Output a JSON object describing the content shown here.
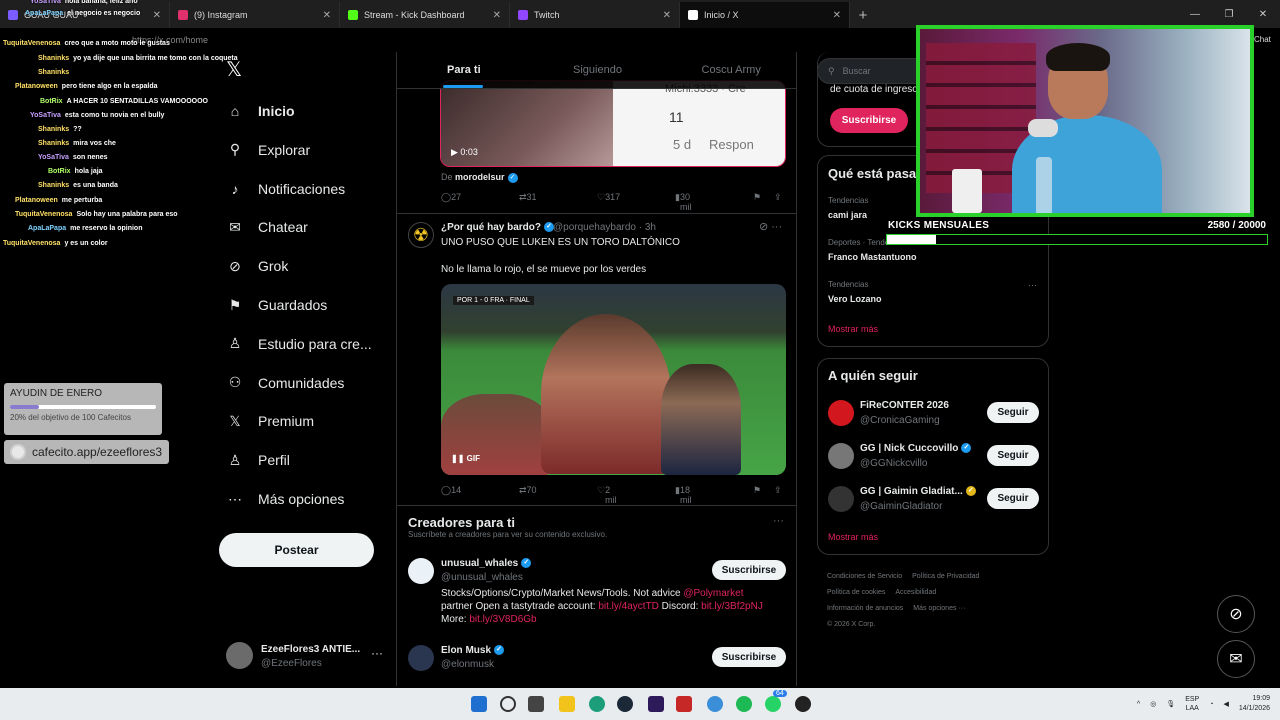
{
  "browser": {
    "tabs": [
      {
        "label": "GUAU GUAU",
        "prefix": "6dBqRix",
        "color": "#7b5cff"
      },
      {
        "label": "(9) Instagram",
        "color": "#e1306c"
      },
      {
        "label": "Stream - Kick Dashboard",
        "color": "#53fc18"
      },
      {
        "label": "Twitch",
        "color": "#9146ff"
      },
      {
        "label": "Inicio / X",
        "color": "#ffffff"
      }
    ],
    "url": "https://x.com/home",
    "chat_label": "Chat"
  },
  "chat": [
    {
      "user": "YoSaTiva",
      "text": "hola banana, feliz año",
      "color": "#c8a2ff"
    },
    {
      "user": "ApaLaPapa",
      "text": "el negocio es negocio",
      "color": "#7fd3ff"
    },
    {
      "user": "TuquitaVenenosa",
      "text": "creo que a moto moto le gustas",
      "color": "#ffe066"
    },
    {
      "user": "Shaninks",
      "text": "yo ya dije que una birrita me tomo con la coqueta",
      "color": "#ffe066"
    },
    {
      "user": "Shaninks",
      "text": "",
      "color": "#ffe066"
    },
    {
      "user": "Platanoween",
      "text": "pero tiene algo en la espalda",
      "color": "#ffe066"
    },
    {
      "user": "BotRix",
      "text": "A HACER 10 SENTADILLAS VAMOOOOOO",
      "color": "#b0ff6a"
    },
    {
      "user": "YoSaTiva",
      "text": "esta como tu novia en el bully",
      "color": "#c8a2ff"
    },
    {
      "user": "Shaninks",
      "text": "??",
      "color": "#ffe066"
    },
    {
      "user": "Shaninks",
      "text": "mira vos che",
      "color": "#ffe066"
    },
    {
      "user": "YoSaTiva",
      "text": "son nenes",
      "color": "#c8a2ff"
    },
    {
      "user": "BotRix",
      "text": "hola jaja",
      "color": "#b0ff6a"
    },
    {
      "user": "Shaninks",
      "text": "es una banda",
      "color": "#ffe066"
    },
    {
      "user": "Platanoween",
      "text": "me perturba",
      "color": "#ffe066"
    },
    {
      "user": "TuquitaVenenosa",
      "text": "Solo hay una palabra para eso",
      "color": "#ffe066"
    },
    {
      "user": "ApaLaPapa",
      "text": "me reservo la opinion",
      "color": "#7fd3ff"
    },
    {
      "user": "TuquitaVenenosa",
      "text": "y es un color",
      "color": "#ffe066"
    }
  ],
  "donation": {
    "title": "AYUDIN DE ENERO",
    "progress": 0.2,
    "subtitle": "20% del objetivo de 100 Cafecitos",
    "link": "cafecito.app/ezeeflores3"
  },
  "sidebar": {
    "items": [
      {
        "label": "Inicio",
        "icon": "home-icon",
        "glyph": "⌂"
      },
      {
        "label": "Explorar",
        "icon": "search-icon",
        "glyph": "⚲"
      },
      {
        "label": "Notificaciones",
        "icon": "bell-icon",
        "glyph": "♪"
      },
      {
        "label": "Chatear",
        "icon": "mail-icon",
        "glyph": "✉"
      },
      {
        "label": "Grok",
        "icon": "grok-icon",
        "glyph": "⊘"
      },
      {
        "label": "Guardados",
        "icon": "bookmark-icon",
        "glyph": "⚑"
      },
      {
        "label": "Estudio para cre...",
        "icon": "flask-icon",
        "glyph": "♙"
      },
      {
        "label": "Comunidades",
        "icon": "people-icon",
        "glyph": "⚇"
      },
      {
        "label": "Premium",
        "icon": "x-premium-icon",
        "glyph": "𝕏"
      },
      {
        "label": "Perfil",
        "icon": "person-icon",
        "glyph": "♙"
      },
      {
        "label": "Más opciones",
        "icon": "more-circle-icon",
        "glyph": "⋯"
      }
    ],
    "post_label": "Postear",
    "account": {
      "name": "EzeeFlores3 ANTIE...",
      "handle": "@EzeeFlores"
    }
  },
  "feed": {
    "tabs": [
      "Para ti",
      "Siguiendo",
      "Coscu Army"
    ],
    "tweet1": {
      "video_time": "0:03",
      "overlay_name": "Michi.3333 · Cre",
      "overlay_count": "11",
      "overlay_age": "5 d",
      "overlay_reply": "Respon",
      "source_prefix": "De",
      "source_user": "morodelsur",
      "replies": "27",
      "reposts": "31",
      "likes": "317",
      "views": "30 mil"
    },
    "tweet2": {
      "name": "¿Por qué hay bardo?",
      "handle": "@porquehaybardo · 3h",
      "text1": "UNO PUSO QUE LUKEN ES UN TORO DALTÓNICO",
      "text2": "No le llama lo rojo, el se mueve por los verdes",
      "score": "POR 1 - 0 FRA · FINAL",
      "media_tag": "GIF",
      "replies": "14",
      "reposts": "70",
      "likes": "2 mil",
      "views": "18 mil"
    },
    "creators": {
      "title": "Creadores para ti",
      "subtitle": "Suscríbete a creadores para ver su contenido exclusivo.",
      "subscribe_label": "Suscribirse",
      "list": [
        {
          "name": "unusual_whales",
          "handle": "@unusual_whales",
          "bio1": "Stocks/Options/Crypto/Market News/Tools. Not advice ",
          "bio1_link": "@Polymarket",
          "bio2": "partner Open a tastytrade account: ",
          "bio2_link": "bit.ly/4ayctTD",
          "bio2b": " Discord: ",
          "bio2b_link": "bit.ly/3Bf2pNJ",
          "bio3": "More: ",
          "bio3_link": "bit.ly/3V8D6Gb"
        },
        {
          "name": "Elon Musk",
          "handle": "@elonmusk"
        }
      ]
    }
  },
  "right": {
    "search_placeholder": "Buscar",
    "premium_text": "de cuota de ingresos",
    "subscribe_label": "Suscribirse",
    "trends_title": "Qué está pasa",
    "trends": [
      {
        "category": "Tendencias",
        "name": "cami jara"
      },
      {
        "category": "Deportes · Tendencias",
        "name": "Franco Mastantuono"
      },
      {
        "category": "Tendencias",
        "name": "Vero Lozano"
      }
    ],
    "show_more": "Mostrar más",
    "follow_title": "A quién seguir",
    "follow_label": "Seguir",
    "follow": [
      {
        "name": "FiReCONTER 2026",
        "handle": "@CronicaGaming",
        "color": "#d3171e"
      },
      {
        "name": "GG | Nick Cuccovillo",
        "handle": "@GGNickcvillo",
        "color": "#777777"
      },
      {
        "name": "GG | Gaimin Gladiat...",
        "handle": "@GaiminGladiator",
        "color": "#333333"
      }
    ],
    "footer": [
      "Condiciones de Servicio",
      "Política de Privacidad",
      "Política de cookies",
      "Accesibilidad",
      "Información de anuncios",
      "Más opciones ···",
      "© 2026 X Corp."
    ]
  },
  "stream": {
    "kicks_label": "KICKS MENSUALES",
    "kicks_value": "2580  / 20000",
    "kicks_progress": 0.129
  },
  "taskbar": {
    "time": "19:09",
    "date": "14/1/2026",
    "lang1": "ESP",
    "lang2": "LAA",
    "badge": "64"
  }
}
